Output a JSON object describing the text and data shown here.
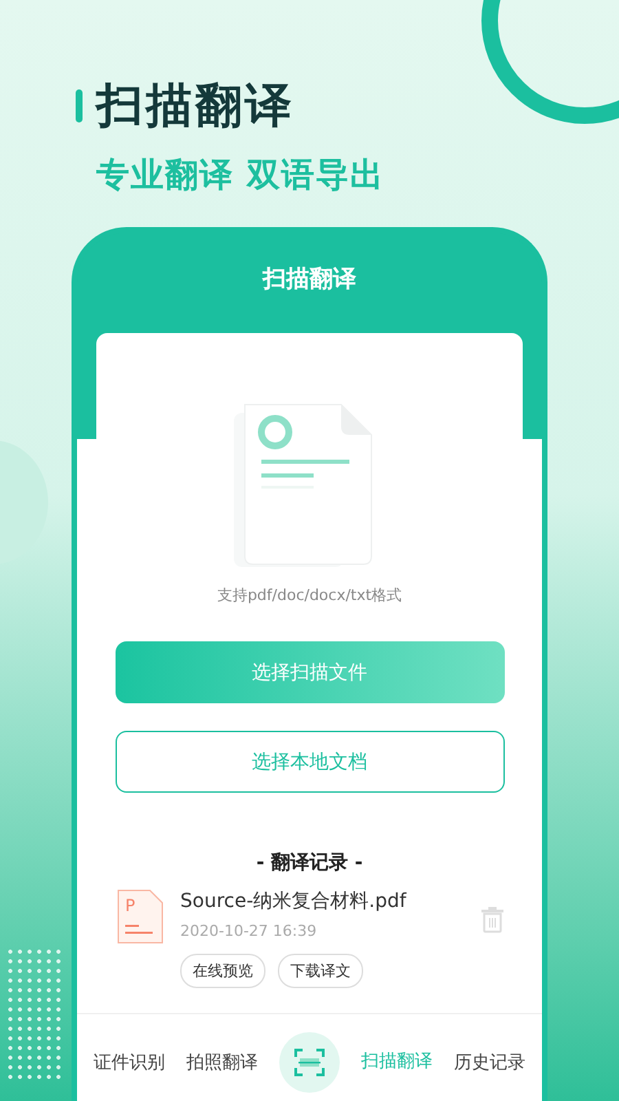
{
  "promo": {
    "headline": "扫描翻译",
    "subheadline": "专业翻译 双语导出"
  },
  "screen": {
    "title": "扫描翻译",
    "format_hint": "支持pdf/doc/docx/txt格式",
    "buttons": [
      {
        "label": "选择扫描文件",
        "kind": "primary"
      },
      {
        "label": "选择本地文档",
        "kind": "outline"
      }
    ],
    "records": {
      "title": "- 翻译记录 -",
      "items": [
        {
          "icon_letter": "P",
          "filename": "Source-纳米复合材料.pdf",
          "time": "2020-10-27 16:39",
          "actions": [
            "在线预览",
            "下载译文"
          ]
        }
      ]
    }
  },
  "tabs": [
    {
      "kind": "text",
      "label": "证件识别",
      "selected": false
    },
    {
      "kind": "text",
      "label": "拍照翻译",
      "selected": false
    },
    {
      "kind": "scan",
      "selected": false
    },
    {
      "kind": "text",
      "label": "扫描翻译",
      "selected": true
    },
    {
      "kind": "text",
      "label": "历史记录",
      "selected": false
    }
  ]
}
